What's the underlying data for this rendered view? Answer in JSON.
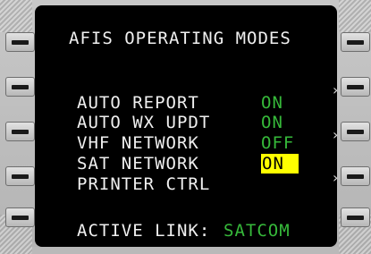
{
  "title": "AFIS OPERATING MODES",
  "rows": [
    {
      "label": "AUTO REPORT",
      "value": "ON"
    },
    {
      "label": "AUTO WX UPDT",
      "value": "ON"
    },
    {
      "label": "VHF NETWORK",
      "value": "OFF"
    },
    {
      "label": "SAT NETWORK",
      "value": "ON"
    },
    {
      "label": "PRINTER CTRL",
      "value": ""
    }
  ],
  "active_link": {
    "label": "ACTIVE LINK:",
    "value": "SATCOM"
  },
  "colors": {
    "background": "#000000",
    "label": "#f0f0f0",
    "value": "#36b93a",
    "selected": "#ffff00"
  },
  "arrow_glyph": "›"
}
